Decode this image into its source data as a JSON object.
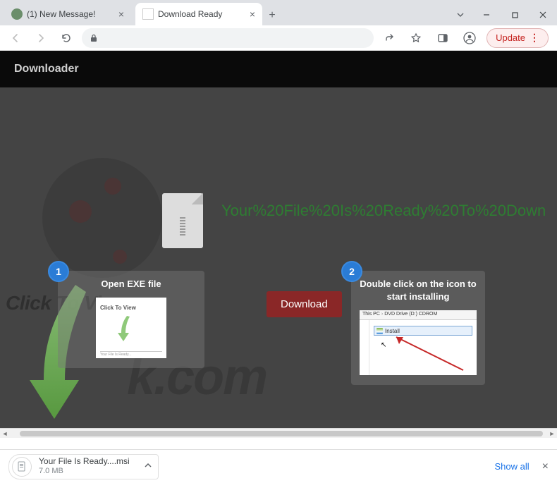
{
  "tabs": [
    {
      "title": "(1) New Message!",
      "active": false
    },
    {
      "title": "Download Ready",
      "active": true
    }
  ],
  "update_label": "Update",
  "page": {
    "header": "Downloader",
    "headline": "Your%20File%20Is%20Ready%20To%20Down",
    "download_label": "Download",
    "watermark1": "Click To View",
    "watermark_big": "k.com"
  },
  "steps": {
    "one": {
      "num": "1",
      "title": "Open EXE file",
      "thumb_text": "Click To View",
      "thumb_footer": "Your File Is Ready..."
    },
    "two": {
      "num": "2",
      "title": "Double click on the icon to start installing",
      "breadcrumb": {
        "root": "This PC",
        "drive": "DVD Drive (D:) CDROM"
      },
      "item": "Install"
    }
  },
  "download_shelf": {
    "filename": "Your File Is Ready....msi",
    "size": "7.0 MB",
    "show_all": "Show all"
  }
}
